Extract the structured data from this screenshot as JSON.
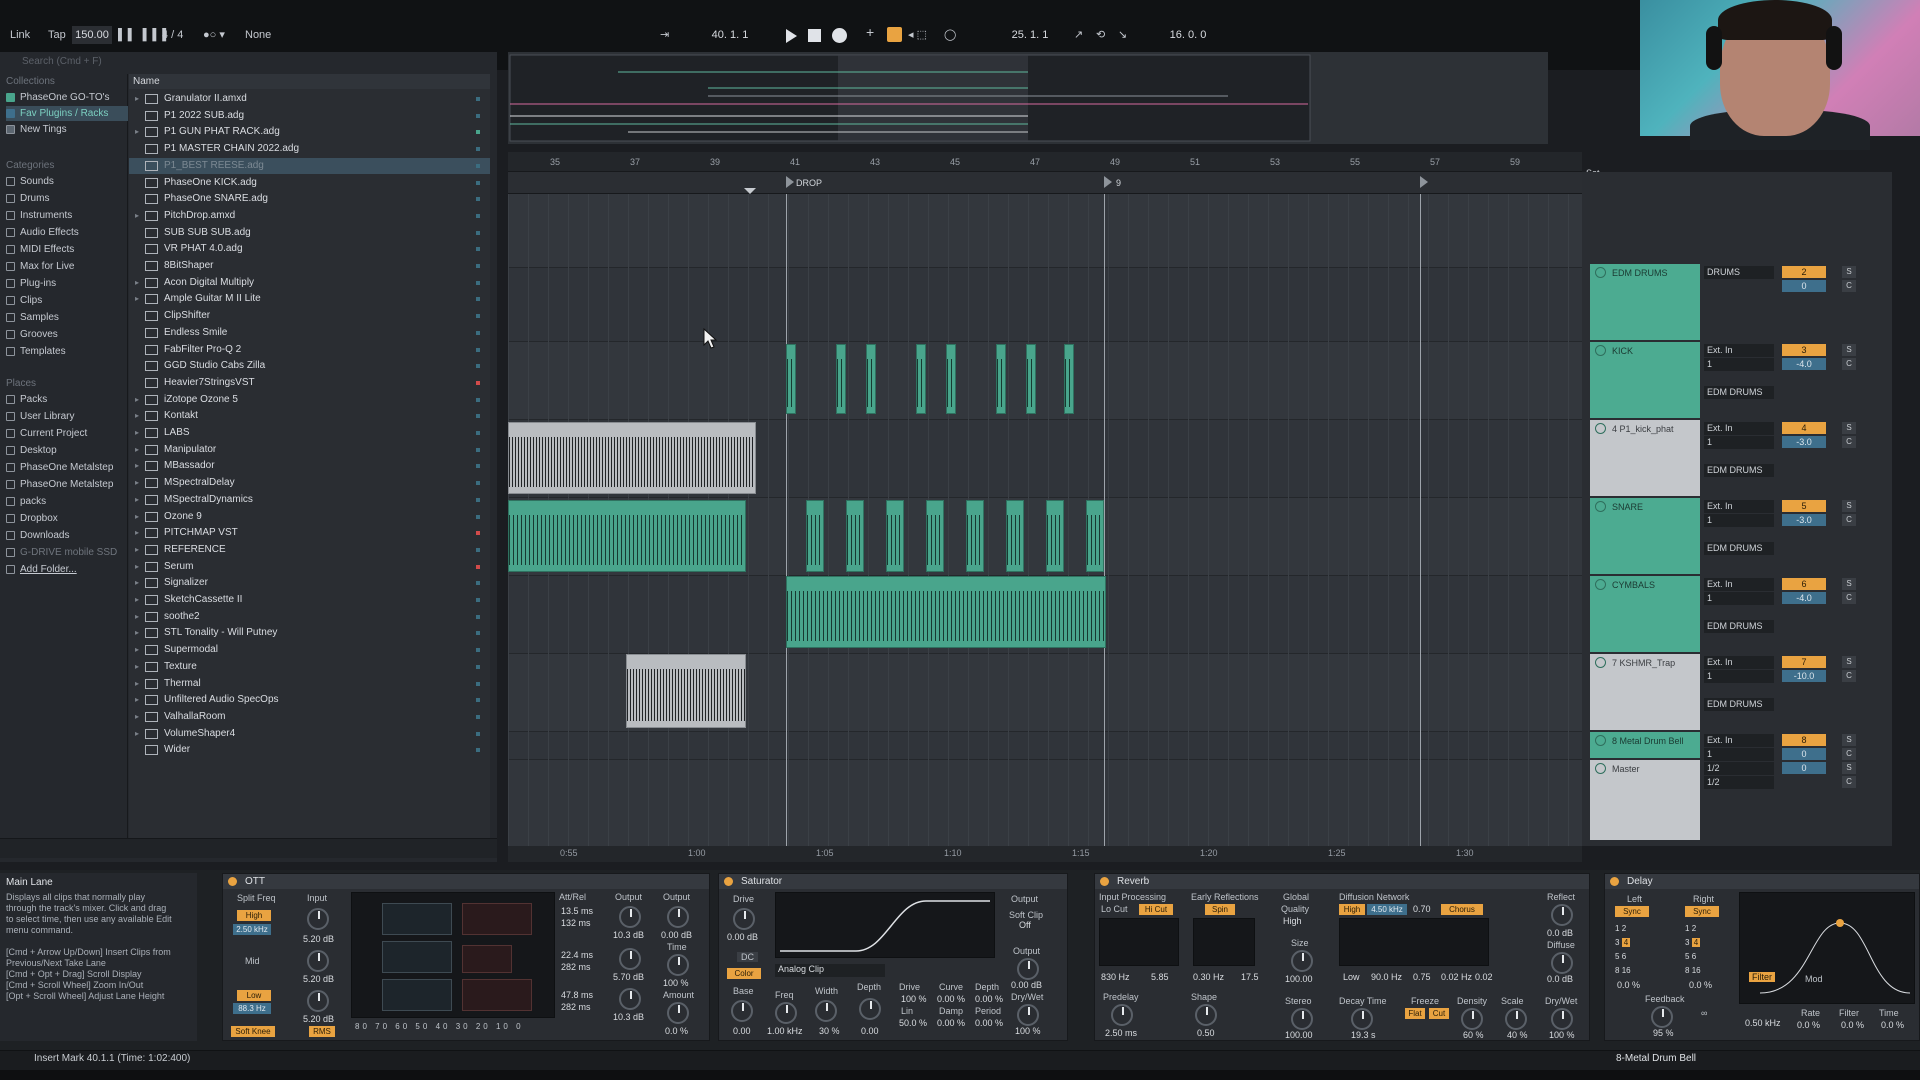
{
  "transport": {
    "link": "Link",
    "tap": "Tap",
    "tempo": "150.00",
    "signature": "4 / 4",
    "follow": "None",
    "position": "40.  1.  1",
    "loop_start": "25.  1.  1",
    "loop_length": "16.  0.  0"
  },
  "browser": {
    "search_placeholder": "Search (Cmd + F)",
    "collections_label": "Collections",
    "collections": [
      "PhaseOne GO-TO's",
      "Fav Plugins / Racks",
      "New Tings"
    ],
    "categories_label": "Categories",
    "categories": [
      "Sounds",
      "Drums",
      "Instruments",
      "Audio Effects",
      "MIDI Effects",
      "Max for Live",
      "Plug-ins",
      "Clips",
      "Samples",
      "Grooves",
      "Templates"
    ],
    "places_label": "Places",
    "places": [
      "Packs",
      "User Library",
      "Current Project",
      "Desktop",
      "PhaseOne Metalstep",
      "PhaseOne Metalstep",
      "packs",
      "Dropbox",
      "Downloads",
      "G-DRIVE mobile SSD",
      "Add Folder..."
    ],
    "name_header": "Name",
    "files": [
      "Granulator II.amxd",
      "P1 2022 SUB.adg",
      "P1 GUN PHAT RACK.adg",
      "P1 MASTER CHAIN 2022.adg",
      "P1_BEST REESE.adg",
      "PhaseOne KICK.adg",
      "PhaseOne SNARE.adg",
      "PitchDrop.amxd",
      "SUB SUB SUB.adg",
      "VR PHAT 4.0.adg",
      "8BitShaper",
      "Acon Digital Multiply",
      "Ample Guitar M II Lite",
      "ClipShifter",
      "Endless Smile",
      "FabFilter Pro-Q 2",
      "GGD Studio Cabs Zilla",
      "Heavier7StringsVST",
      "iZotope Ozone 5",
      "Kontakt",
      "LABS",
      "Manipulator",
      "MBassador",
      "MSpectralDelay",
      "MSpectralDynamics",
      "Ozone 9",
      "PITCHMAP VST",
      "REFERENCE",
      "Serum",
      "Signalizer",
      "SketchCassette II",
      "soothe2",
      "STL Tonality - Will Putney",
      "Supermodal",
      "Texture",
      "Thermal",
      "Unfiltered Audio SpecOps",
      "ValhallaRoom",
      "VolumeShaper4",
      "Wider"
    ]
  },
  "arrangement": {
    "bars": [
      "35",
      "37",
      "39",
      "41",
      "43",
      "45",
      "47",
      "49",
      "51",
      "53",
      "55",
      "57",
      "59"
    ],
    "locators": [
      "DROP",
      "9"
    ],
    "times": [
      "0:55",
      "1:00",
      "1:05",
      "1:10",
      "1:15",
      "1:20",
      "1:25",
      "1:30"
    ],
    "set_label": "Set"
  },
  "tracks": [
    {
      "name": "EDM DRUMS",
      "input": "DRUMS",
      "number": "2",
      "volume": "0",
      "pan": "C"
    },
    {
      "name": "KICK",
      "input": "Ext. In",
      "channel": "1",
      "output": "EDM DRUMS",
      "number": "3",
      "volume": "-4.0",
      "pan": "C"
    },
    {
      "name": "4 P1_kick_phat",
      "input": "Ext. In",
      "channel": "1",
      "output": "EDM DRUMS",
      "number": "4",
      "volume": "-3.0",
      "pan": "C"
    },
    {
      "name": "SNARE",
      "input": "Ext. In",
      "channel": "1",
      "output": "EDM DRUMS",
      "number": "5",
      "volume": "-3.0",
      "pan": "C"
    },
    {
      "name": "CYMBALS",
      "input": "Ext. In",
      "channel": "1",
      "output": "EDM DRUMS",
      "number": "6",
      "volume": "-4.0",
      "pan": "C"
    },
    {
      "name": "7 KSHMR_Trap",
      "input": "Ext. In",
      "channel": "1",
      "output": "EDM DRUMS",
      "number": "7",
      "volume": "-10.0",
      "pan": "C"
    },
    {
      "name": "8 Metal Drum Bell",
      "input": "Ext. In",
      "channel": "1",
      "number": "8",
      "volume": "0",
      "pan": "C"
    },
    {
      "name": "Master",
      "input": "1/2",
      "output": "1/2",
      "volume": "0",
      "pan": "C"
    }
  ],
  "info": {
    "title": "Main Lane",
    "body": "Displays all clips that normally play\nthrough the track's mixer. Click and drag\nto select time, then use any available Edit\nmenu command.\n\n[Cmd + Arrow Up/Down] Insert Clips from\nPrevious/Next Take Lane\n[Cmd + Opt + Drag] Scroll Display\n[Cmd + Scroll Wheel] Zoom In/Out\n[Opt + Scroll Wheel] Adjust Lane Height"
  },
  "devices": {
    "ott": {
      "title": "OTT",
      "split_freq": "Split Freq",
      "input": "Input",
      "high": "High",
      "high_freq": "2.50 kHz",
      "mid": "Mid",
      "low": "Low",
      "low_freq": "88.3 Hz",
      "soft_knee": "Soft Knee",
      "rms": "RMS",
      "gain_high": "5.20 dB",
      "gain_mid": "5.20 dB",
      "gain_low": "5.20 dB",
      "att_rel": "Att/Rel",
      "times": [
        "13.5 ms",
        "132 ms",
        "22.4 ms",
        "282 ms",
        "47.8 ms",
        "282 ms"
      ],
      "output": "Output",
      "output_vals": [
        "10.3 dB",
        "5.70 dB",
        "10.3 dB"
      ],
      "output2": "Output",
      "output2_val": "0.00 dB",
      "time": "Time",
      "time_val": "100 %",
      "amount": "Amount",
      "amount_val": "0.0 %",
      "scale": [
        "80",
        "70",
        "60",
        "50",
        "40",
        "30",
        "20",
        "10",
        "0"
      ]
    },
    "saturator": {
      "title": "Saturator",
      "drive": "Drive",
      "drive_val": "0.00 dB",
      "dc": "DC",
      "color": "Color",
      "mode": "Analog Clip",
      "output": "Output",
      "soft_clip": "Soft Clip",
      "soft_clip_val": "Off",
      "output_val": "0.00 dB",
      "drywet": "Dry/Wet",
      "drywet_val": "100 %",
      "base": "Base",
      "base_val": "0.00",
      "freq": "Freq",
      "freq_val": "1.00 kHz",
      "width": "Width",
      "width_val": "30 %",
      "depth": "Depth",
      "depth_val": "0.00",
      "drive2": "Drive",
      "drive2_val": "100 %",
      "lin": "Lin",
      "lin_val": "50.0 %",
      "curve": "Curve",
      "curve_val": "0.00 %",
      "damp": "Damp",
      "damp_val": "0.00 %",
      "depth2": "Depth",
      "depth2_val": "0.00 %",
      "period": "Period",
      "period_val": "0.00 %"
    },
    "reverb": {
      "title": "Reverb",
      "input_processing": "Input Processing",
      "lo_cut": "Lo Cut",
      "hi_cut": "Hi Cut",
      "lo_val": "830 Hz",
      "q_val": "5.85",
      "early_reflections": "Early Reflections",
      "spin": "Spin",
      "er_val1": "0.30 Hz",
      "er_val2": "17.5",
      "global": "Global",
      "quality": "Quality",
      "quality_val": "High",
      "size": "Size",
      "size_val": "100.00",
      "diffusion": "Diffusion Network",
      "high": "High",
      "high_freq": "4.50 kHz",
      "high_val": "0.70",
      "chorus": "Chorus",
      "low": "Low",
      "low_freq": "90.0 Hz",
      "low_val": "0.75",
      "chorus_val1": "0.02 Hz",
      "chorus_val2": "0.02",
      "reflect": "Reflect",
      "reflect_val": "0.0 dB",
      "diffuse": "Diffuse",
      "diffuse_val": "0.0 dB",
      "predelay": "Predelay",
      "predelay_val": "2.50 ms",
      "shape": "Shape",
      "shape_val": "0.50",
      "stereo": "Stereo",
      "stereo_val": "100.00",
      "decay": "Decay Time",
      "decay_val": "19.3 s",
      "freeze": "Freeze",
      "flat": "Flat",
      "cut": "Cut",
      "density": "Density",
      "density_val": "60 %",
      "scale": "Scale",
      "scale_val": "40 %",
      "drywet": "Dry/Wet",
      "drywet_val": "100 %"
    },
    "delay": {
      "title": "Delay",
      "left": "Left",
      "right": "Right",
      "sync": "Sync",
      "left_val": "0.0 %",
      "right_val": "0.0 %",
      "grid": [
        "1",
        "2",
        "3",
        "4",
        "5",
        "6",
        "8",
        "16"
      ],
      "feedback": "Feedback",
      "feedback_val": "95 %",
      "filter": "Filter",
      "freq_val": "0.50 kHz",
      "rate": "Rate",
      "rate_val": "0.0 %",
      "filter_label": "Filter",
      "filter_val": "0.0 %",
      "time": "Time",
      "time_val": "0.0 %",
      "mod": "Mod"
    }
  },
  "status": {
    "text": "Insert Mark 40.1.1 (Time: 1:02:400)",
    "track": "8-Metal Drum Bell"
  },
  "colors": {
    "clip_green": "#49a58c",
    "accent_orange": "#e9a341",
    "clip_grey": "#b9bcc0"
  }
}
